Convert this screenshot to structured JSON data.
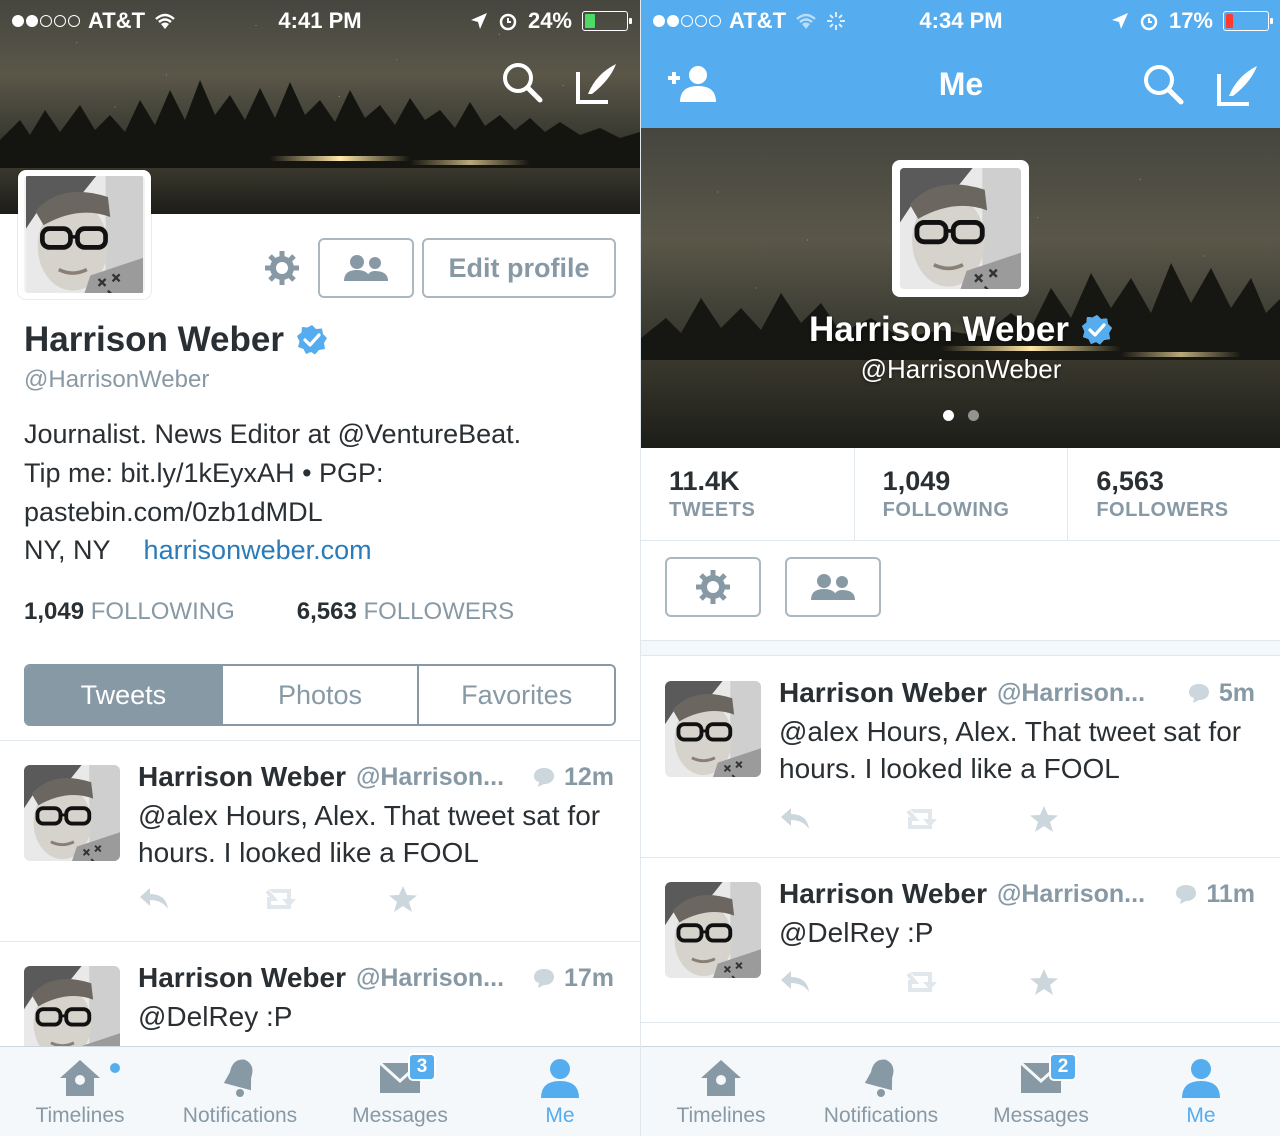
{
  "colors": {
    "brand": "#55acee",
    "text": "#292f33",
    "muted": "#8899a6",
    "link": "#2b7bb9",
    "battery_left": "#4cd964",
    "battery_right": "#ff3b30"
  },
  "left": {
    "status": {
      "carrier": "AT&T",
      "time": "4:41 PM",
      "battery": "24%",
      "battery_level": 0.24
    },
    "profile": {
      "name": "Harrison Weber",
      "handle": "@HarrisonWeber",
      "edit_profile": "Edit profile",
      "bio_line1": "Journalist. News Editor at @VentureBeat.",
      "bio_line2": "Tip me: bit.ly/1kEyxAH • PGP:",
      "bio_line3": "pastebin.com/0zb1dMDL",
      "location": "NY, NY",
      "website": "harrisonweber.com",
      "following_count": "1,049",
      "following_label": "FOLLOWING",
      "followers_count": "6,563",
      "followers_label": "FOLLOWERS"
    },
    "tabs": [
      "Tweets",
      "Photos",
      "Favorites"
    ],
    "tweets": [
      {
        "name": "Harrison Weber",
        "handle": "@Harrison...",
        "time": "12m",
        "text": "@alex Hours, Alex. That tweet sat for hours. I looked like a FOOL"
      },
      {
        "name": "Harrison Weber",
        "handle": "@Harrison...",
        "time": "17m",
        "text": "@DelRey :P"
      }
    ],
    "tabbar": [
      {
        "label": "Timelines",
        "icon": "home-icon"
      },
      {
        "label": "Notifications",
        "icon": "bell-icon"
      },
      {
        "label": "Messages",
        "icon": "envelope-icon",
        "badge": "3"
      },
      {
        "label": "Me",
        "icon": "person-icon"
      }
    ]
  },
  "right": {
    "status": {
      "carrier": "AT&T",
      "time": "4:34 PM",
      "battery": "17%",
      "battery_level": 0.17
    },
    "nav_title": "Me",
    "profile": {
      "name": "Harrison Weber",
      "handle": "@HarrisonWeber"
    },
    "stats": [
      {
        "value": "11.4K",
        "label": "TWEETS"
      },
      {
        "value": "1,049",
        "label": "FOLLOWING"
      },
      {
        "value": "6,563",
        "label": "FOLLOWERS"
      }
    ],
    "tweets": [
      {
        "name": "Harrison Weber",
        "handle": "@Harrison...",
        "time": "5m",
        "text": "@alex Hours, Alex. That tweet sat for hours. I looked like a FOOL"
      },
      {
        "name": "Harrison Weber",
        "handle": "@Harrison...",
        "time": "11m",
        "text": "@DelRey :P"
      }
    ],
    "tabbar": [
      {
        "label": "Timelines",
        "icon": "home-icon"
      },
      {
        "label": "Notifications",
        "icon": "bell-icon"
      },
      {
        "label": "Messages",
        "icon": "envelope-icon",
        "badge": "2"
      },
      {
        "label": "Me",
        "icon": "person-icon"
      }
    ]
  }
}
